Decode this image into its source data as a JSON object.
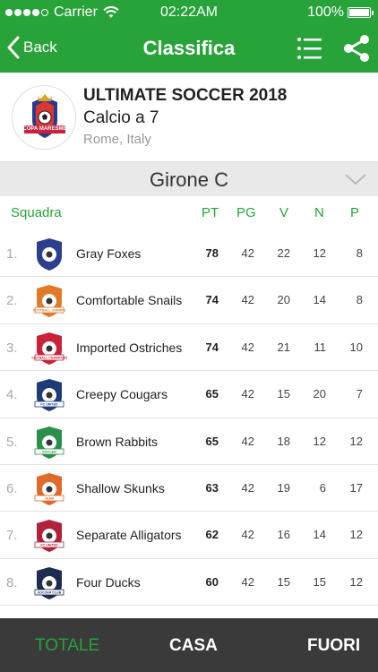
{
  "status_bar": {
    "carrier": "Carrier",
    "time": "02:22AM",
    "battery": "100%"
  },
  "nav": {
    "back_label": "Back",
    "title": "Classifica"
  },
  "tournament": {
    "name": "ULTIMATE SOCCER 2018",
    "type": "Calcio a 7",
    "location": "Rome, Italy",
    "logo_text": "COPA MARESME"
  },
  "group": {
    "label": "Girone C"
  },
  "columns": {
    "team": "Squadra",
    "pt": "PT",
    "pg": "PG",
    "v": "V",
    "n": "N",
    "p": "P"
  },
  "standings": [
    {
      "pos": "1.",
      "team": "Gray Foxes",
      "pt": "78",
      "pg": "42",
      "v": "22",
      "n": "12",
      "p": "8",
      "badge_color": "#2b3f8f",
      "badge_text": ""
    },
    {
      "pos": "2.",
      "team": "Comfortable Snails",
      "pt": "74",
      "pg": "42",
      "v": "20",
      "n": "14",
      "p": "8",
      "badge_color": "#e07a2a",
      "badge_text": "FOOTBALL CHAMPS"
    },
    {
      "pos": "3.",
      "team": "Imported Ostriches",
      "pt": "74",
      "pg": "42",
      "v": "21",
      "n": "11",
      "p": "10",
      "badge_color": "#c8233a",
      "badge_text": "FOOTBALL CHAMPIONS"
    },
    {
      "pos": "4.",
      "team": "Creepy Cougars",
      "pt": "65",
      "pg": "42",
      "v": "15",
      "n": "20",
      "p": "7",
      "badge_color": "#1f3b7a",
      "badge_text": "FC UNITED"
    },
    {
      "pos": "5.",
      "team": "Brown Rabbits",
      "pt": "65",
      "pg": "42",
      "v": "18",
      "n": "12",
      "p": "12",
      "badge_color": "#2a8f4a",
      "badge_text": "SOCCER"
    },
    {
      "pos": "6.",
      "team": "Shallow Skunks",
      "pt": "63",
      "pg": "42",
      "v": "19",
      "n": "6",
      "p": "17",
      "badge_color": "#e06a2a",
      "badge_text": "TEAM"
    },
    {
      "pos": "7.",
      "team": "Separate Alligators",
      "pt": "62",
      "pg": "42",
      "v": "16",
      "n": "14",
      "p": "12",
      "badge_color": "#b0223a",
      "badge_text": "FC UNITED"
    },
    {
      "pos": "8.",
      "team": "Four Ducks",
      "pt": "60",
      "pg": "42",
      "v": "15",
      "n": "15",
      "p": "12",
      "badge_color": "#1d2c4f",
      "badge_text": "SOCCER CLUB"
    }
  ],
  "tabs": {
    "totale": "TOTALE",
    "casa": "CASA",
    "fuori": "FUORI"
  },
  "colors": {
    "brand_green": "#27a33a",
    "tabbar_bg": "#3a3a3a",
    "group_bar_bg": "#e9e9e9"
  }
}
